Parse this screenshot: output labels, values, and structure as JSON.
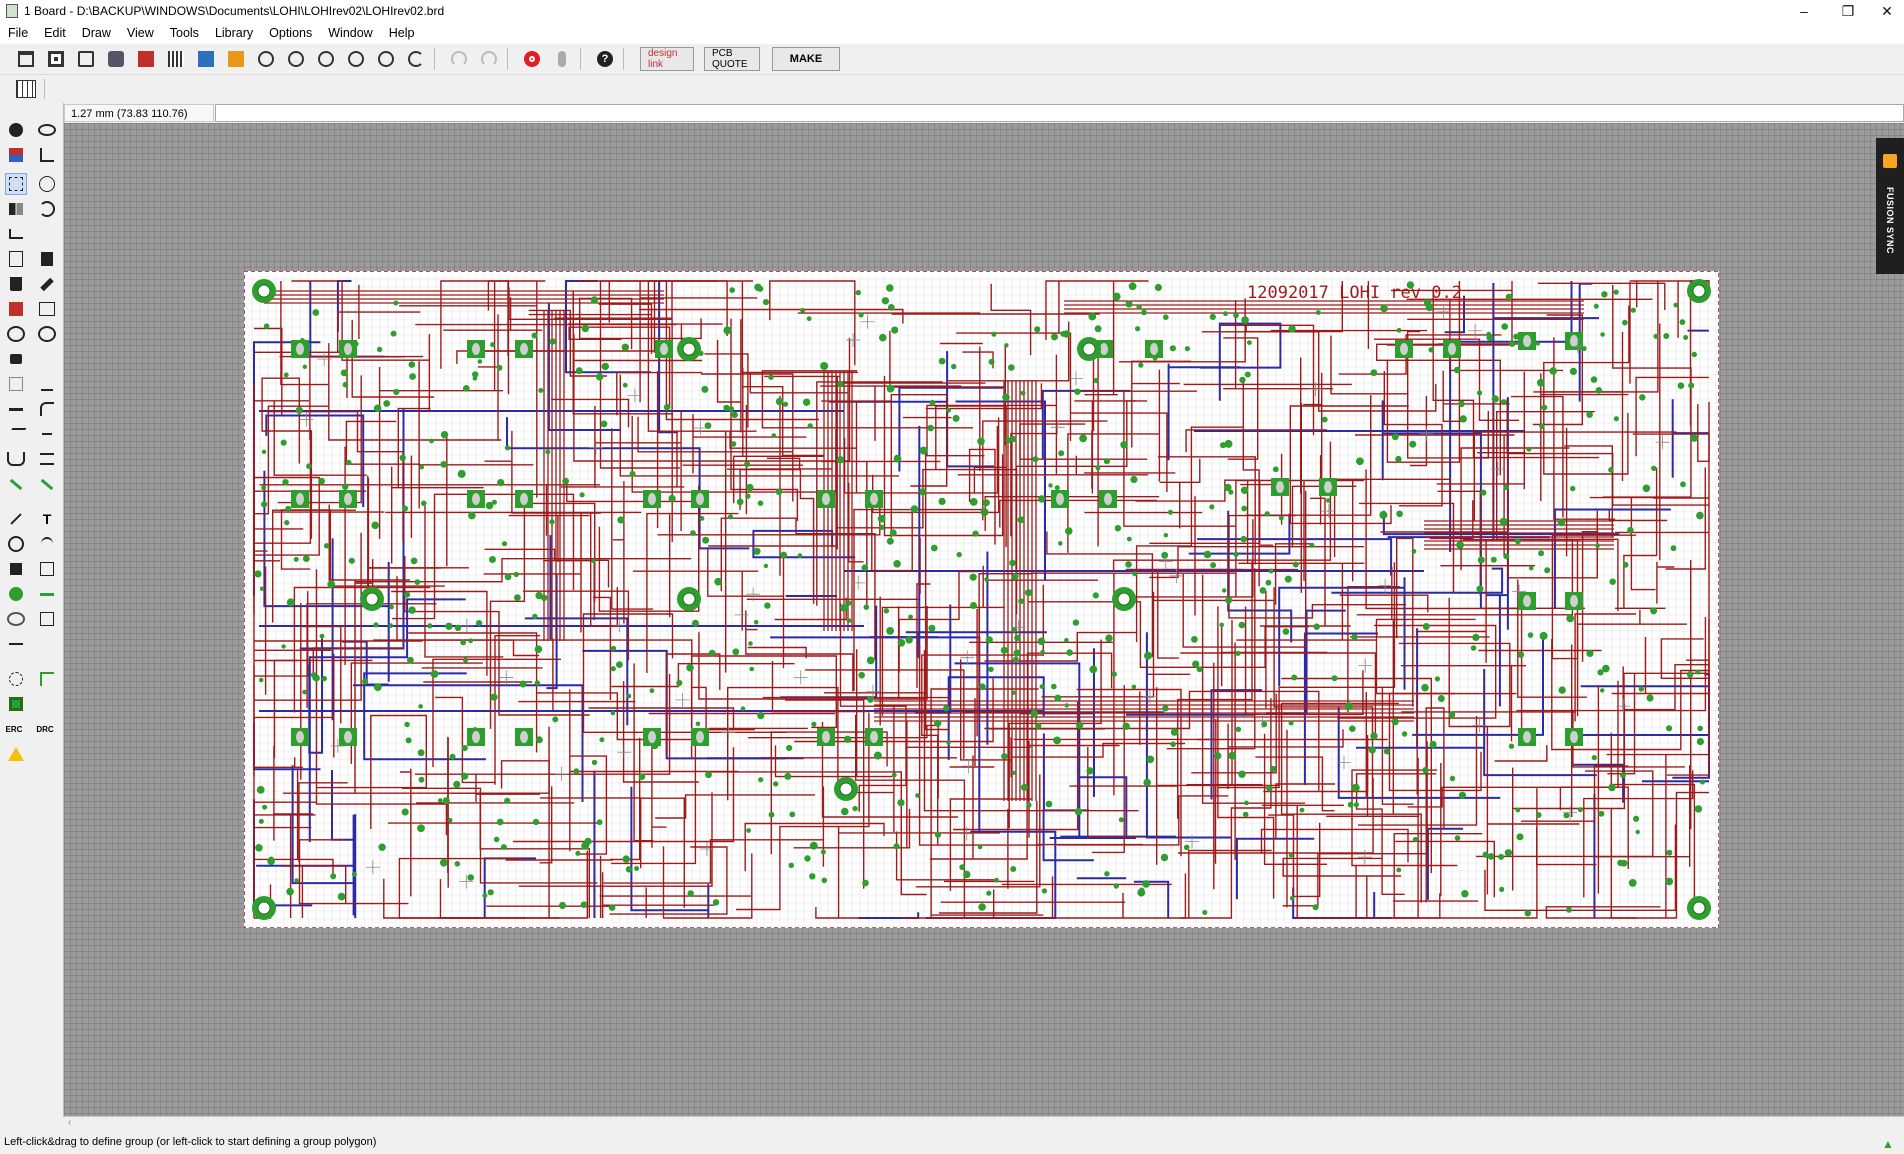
{
  "window": {
    "title": "1 Board - D:\\BACKUP\\WINDOWS\\Documents\\LOHI\\LOHIrev02\\LOHIrev02.brd"
  },
  "menu": [
    "File",
    "Edit",
    "Draw",
    "View",
    "Tools",
    "Library",
    "Options",
    "Window",
    "Help"
  ],
  "toolbar": {
    "design_link": "design link",
    "pcb_quote": "PCB QUOTE",
    "make": "MAKE",
    "icons": [
      "open-icon",
      "save-icon",
      "print-icon",
      "cam-icon",
      "scr-icon",
      "ulp-icon",
      "zoom-fit-icon",
      "zoom-in-icon",
      "zoom-out-icon",
      "zoom-select-icon",
      "zoom-last-icon",
      "redraw-icon",
      "undo-icon",
      "redo-icon",
      "stop-icon",
      "go-icon",
      "help-icon"
    ]
  },
  "coordinates": "1.27 mm (73.83 110.76)",
  "board": {
    "label": "12092017 LOHI rev 0.2"
  },
  "fusion_panel": {
    "label": "FUSION SYNC"
  },
  "left_tools": {
    "erc": "ERC",
    "drc": "DRC"
  },
  "status": "Left-click&drag to define group (or left-click to start defining a group polygon)",
  "colors": {
    "top_copper": "#9e1b1b",
    "bottom_copper": "#2b2ba8",
    "pad": "#2e9e2e",
    "board_bg": "#ffffff",
    "canvas_grid": "#9b9b9b"
  }
}
